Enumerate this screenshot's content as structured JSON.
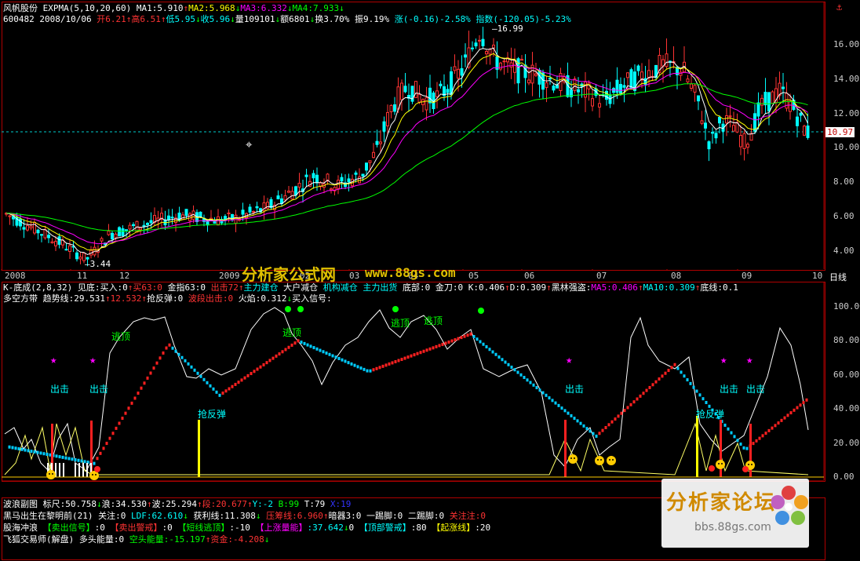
{
  "main_header": {
    "line1": [
      {
        "t": "风帆股份",
        "c": "#ffffff"
      },
      {
        "t": " EXPMA(5,10,20,60) ",
        "c": "#ffffff"
      },
      {
        "t": "MA1:5.910",
        "c": "#ffffff"
      },
      {
        "t": "↑",
        "c": "#ff3333"
      },
      {
        "t": "MA2:5.968",
        "c": "#ffff00"
      },
      {
        "t": "↓",
        "c": "#00ff00"
      },
      {
        "t": "MA3:6.332",
        "c": "#ff00ff"
      },
      {
        "t": "↓",
        "c": "#00ff00"
      },
      {
        "t": "MA4:7.933",
        "c": "#00ff00"
      },
      {
        "t": "↓",
        "c": "#00ff00"
      }
    ],
    "line2": [
      {
        "t": "600482 2008/10/06 ",
        "c": "#ffffff"
      },
      {
        "t": "开6.21",
        "c": "#ff3333"
      },
      {
        "t": "↑",
        "c": "#ff3333"
      },
      {
        "t": "高6.51",
        "c": "#ff3333"
      },
      {
        "t": "↑",
        "c": "#ff3333"
      },
      {
        "t": "低5.95",
        "c": "#00ffff"
      },
      {
        "t": "↓",
        "c": "#00ff00"
      },
      {
        "t": "收5.96",
        "c": "#00ffff"
      },
      {
        "t": "↓",
        "c": "#00ff00"
      },
      {
        "t": "量109101",
        "c": "#ffffff"
      },
      {
        "t": "↓",
        "c": "#00ff00"
      },
      {
        "t": "额6801",
        "c": "#ffffff"
      },
      {
        "t": "↓",
        "c": "#00ff00"
      },
      {
        "t": "换3.70%",
        "c": "#ffffff"
      },
      {
        "t": " 振9.19%",
        "c": "#ffffff"
      },
      {
        "t": " 涨(-0.16)-2.58%",
        "c": "#00ffff"
      },
      {
        "t": " 指数(-120.05)-5.23%",
        "c": "#00ffff"
      }
    ]
  },
  "main_axis": {
    "y_ticks": [
      "16.00",
      "14.00",
      "12.00",
      "10.00",
      "8.00",
      "6.00",
      "4.00"
    ],
    "current_price": "10.97",
    "x_ticks": [
      "2008",
      "11",
      "12",
      "2009",
      "02",
      "03",
      "04",
      "05",
      "06",
      "07",
      "08",
      "09",
      "10"
    ],
    "x_unit": "日线",
    "high_label": "16.99",
    "low_label": "3.44"
  },
  "watermark_center": {
    "text1": "分析家公式网",
    "text2": "www.88gs.com"
  },
  "indicator_header": {
    "line1": [
      {
        "t": "K-底成(2,8,32) ",
        "c": "#ffffff"
      },
      {
        "t": "见底:买入:0",
        "c": "#ffffff"
      },
      {
        "t": "↑",
        "c": "#ff3333"
      },
      {
        "t": "买63:0",
        "c": "#ff3333"
      },
      {
        "t": " 金指63:0",
        "c": "#ffffff"
      },
      {
        "t": " 出击72",
        "c": "#ff3333"
      },
      {
        "t": "↑",
        "c": "#ff3333"
      },
      {
        "t": "主力建仓",
        "c": "#00ffff"
      },
      {
        "t": " 大户减仓",
        "c": "#ffffff"
      },
      {
        "t": " 机构减仓",
        "c": "#00ffff"
      },
      {
        "t": " 主力出货",
        "c": "#00ffff"
      },
      {
        "t": " 底部:0",
        "c": "#ffffff"
      },
      {
        "t": " 金刀:0",
        "c": "#ffffff"
      },
      {
        "t": " K:0.406",
        "c": "#ffffff"
      },
      {
        "t": "↑",
        "c": "#ff3333"
      },
      {
        "t": "D:0.309",
        "c": "#ffffff"
      },
      {
        "t": "↑",
        "c": "#ff3333"
      },
      {
        "t": "黑林强盗:",
        "c": "#ffffff"
      },
      {
        "t": "MA5:0.406",
        "c": "#ff00ff"
      },
      {
        "t": "↑",
        "c": "#ff3333"
      },
      {
        "t": "MA10:0.309",
        "c": "#00ffff"
      },
      {
        "t": "↑",
        "c": "#ff3333"
      },
      {
        "t": "底线:0.1",
        "c": "#ffffff"
      }
    ],
    "line2": [
      {
        "t": "多空方带 ",
        "c": "#ffffff"
      },
      {
        "t": "趋势线:29.531",
        "c": "#ffffff"
      },
      {
        "t": "↑",
        "c": "#ff3333"
      },
      {
        "t": "12.532",
        "c": "#ff3333"
      },
      {
        "t": "↑",
        "c": "#ff3333"
      },
      {
        "t": "抢反弹:0",
        "c": "#ffffff"
      },
      {
        "t": " 波段出击:0",
        "c": "#ff3333"
      },
      {
        "t": " 火焰:0.312",
        "c": "#ffffff"
      },
      {
        "t": "↓",
        "c": "#00ff00"
      },
      {
        "t": "买入信号:",
        "c": "#ffffff"
      }
    ]
  },
  "indicator_axis": {
    "y_ticks": [
      "100.00",
      "80.00",
      "60.00",
      "40.00",
      "20.00",
      "0.00"
    ]
  },
  "signals": {
    "escape": "逃顶",
    "attack": "出击",
    "rebound": "抢反弹"
  },
  "bottom_panel": {
    "line1": [
      {
        "t": "波浪副图 ",
        "c": "#ffffff"
      },
      {
        "t": "标尺:50.758",
        "c": "#ffffff"
      },
      {
        "t": "↓",
        "c": "#00ff00"
      },
      {
        "t": "浪:34.530",
        "c": "#ffffff"
      },
      {
        "t": "↑",
        "c": "#ff3333"
      },
      {
        "t": "波:25.294",
        "c": "#ffffff"
      },
      {
        "t": "↑",
        "c": "#ff3333"
      },
      {
        "t": "段:20.677",
        "c": "#ff3333"
      },
      {
        "t": "↑",
        "c": "#ff3333"
      },
      {
        "t": "Y:-2",
        "c": "#00ffff"
      },
      {
        "t": " B:99",
        "c": "#00ff00"
      },
      {
        "t": " T:79",
        "c": "#ffffff"
      },
      {
        "t": " X:19",
        "c": "#3333ff"
      }
    ],
    "line2": [
      {
        "t": "黑马出生在黎明前(21) ",
        "c": "#ffffff"
      },
      {
        "t": "关注:0",
        "c": "#ffffff"
      },
      {
        "t": " LDF:62.610",
        "c": "#00ffff"
      },
      {
        "t": "↓",
        "c": "#00ff00"
      },
      {
        "t": " 获利线:11.308",
        "c": "#ffffff"
      },
      {
        "t": "↓",
        "c": "#00ff00"
      },
      {
        "t": " 压筹线:6.960",
        "c": "#ff3333"
      },
      {
        "t": "↑",
        "c": "#ff3333"
      },
      {
        "t": "暗器3:0",
        "c": "#ffffff"
      },
      {
        "t": " 一踢脚:0",
        "c": "#ffffff"
      },
      {
        "t": " 二踢脚:0",
        "c": "#ffffff"
      },
      {
        "t": " 关注注:0",
        "c": "#ff3333"
      }
    ],
    "line3": [
      {
        "t": "股海冲浪 ",
        "c": "#ffffff"
      },
      {
        "t": "【卖出信号】",
        "c": "#00ff00"
      },
      {
        "t": ":0 ",
        "c": "#ffffff"
      },
      {
        "t": "【卖出警戒】",
        "c": "#ff3333"
      },
      {
        "t": ":0 ",
        "c": "#ffffff"
      },
      {
        "t": "【短线逃顶】",
        "c": "#00ff00"
      },
      {
        "t": ":-10 ",
        "c": "#ffffff"
      },
      {
        "t": "【上涨量能】",
        "c": "#ff00ff"
      },
      {
        "t": ":37.642",
        "c": "#00ffff"
      },
      {
        "t": "↓",
        "c": "#00ff00"
      },
      {
        "t": "0 ",
        "c": "#ffffff"
      },
      {
        "t": "【顶部警戒】",
        "c": "#00ffff"
      },
      {
        "t": ":80 ",
        "c": "#ffffff"
      },
      {
        "t": "【起涨线】",
        "c": "#ffff00"
      },
      {
        "t": ":20",
        "c": "#ffffff"
      }
    ],
    "line4": [
      {
        "t": "飞狐交易师(解盘) ",
        "c": "#ffffff"
      },
      {
        "t": "多头能量:0",
        "c": "#ffffff"
      },
      {
        "t": " 空头能量:-15.197",
        "c": "#00ff00"
      },
      {
        "t": "↑",
        "c": "#ff3333"
      },
      {
        "t": "资金:-4.208",
        "c": "#ff3333"
      },
      {
        "t": "↓",
        "c": "#00ff00"
      }
    ]
  },
  "forum_logo": {
    "title": "分析家论坛",
    "url": "bbs.88gs.com"
  },
  "colors": {
    "up": "#ff3333",
    "down": "#00ffff",
    "ma1": "#ffffff",
    "ma2": "#ffff00",
    "ma3": "#ff00ff",
    "ma4": "#00ff00",
    "border": "#b00000"
  }
}
